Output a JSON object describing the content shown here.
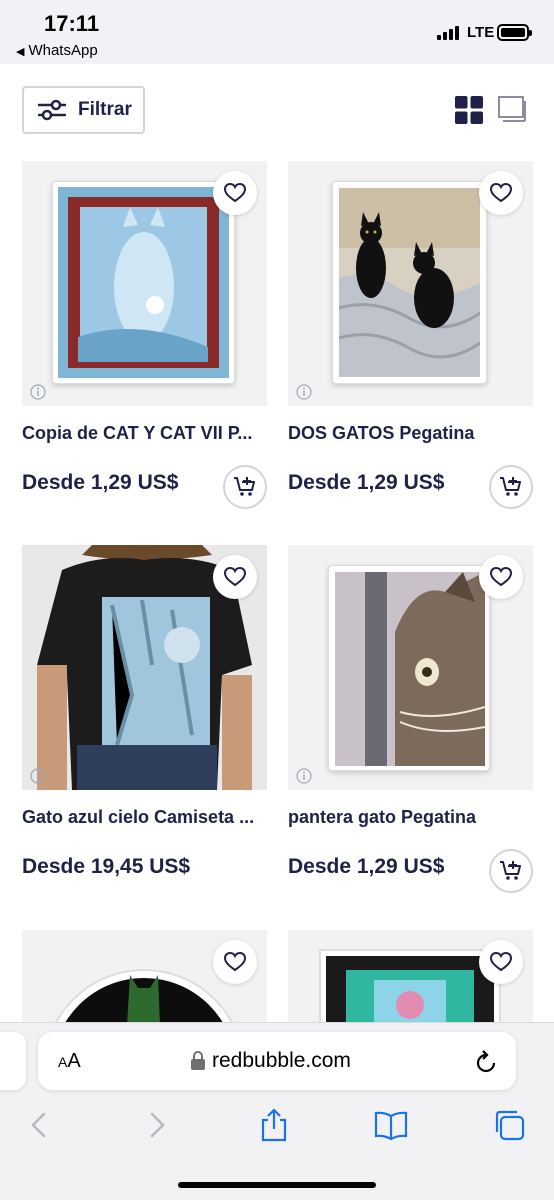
{
  "status_bar": {
    "time": "17:11",
    "back_app": "WhatsApp",
    "network": "LTE"
  },
  "toolbar": {
    "filter_label": "Filtrar"
  },
  "products": [
    {
      "title": "Copia de CAT Y CAT VII P...",
      "price": "Desde 1,29 US$",
      "has_cart": true
    },
    {
      "title": "DOS GATOS Pegatina",
      "price": "Desde 1,29 US$",
      "has_cart": true
    },
    {
      "title": "Gato azul cielo Camiseta ...",
      "price": "Desde 19,45 US$",
      "has_cart": false
    },
    {
      "title": "pantera gato Pegatina",
      "price": "Desde 1,29 US$",
      "has_cart": true
    }
  ],
  "browser": {
    "aa_label_small": "A",
    "aa_label_large": "A",
    "url": "redbubble.com"
  },
  "colors": {
    "brand_text": "#1f2148",
    "border": "#d2d4dc",
    "card_bg": "#f2f2f3",
    "safari_blue": "#1a73e8"
  }
}
